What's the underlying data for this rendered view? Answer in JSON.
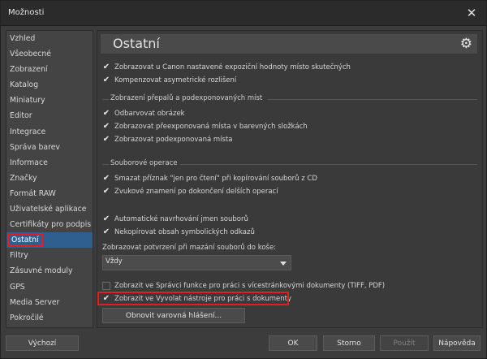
{
  "window": {
    "title": "Možnosti",
    "close_symbol": "✕"
  },
  "sidebar": {
    "items": [
      {
        "label": "Vzhled",
        "active": false
      },
      {
        "label": "Všeobecné",
        "active": false
      },
      {
        "label": "Zobrazení",
        "active": false
      },
      {
        "label": "Katalog",
        "active": false
      },
      {
        "label": "Miniatury",
        "active": false
      },
      {
        "label": "Editor",
        "active": false
      },
      {
        "label": "Integrace",
        "active": false
      },
      {
        "label": "Správa barev",
        "active": false
      },
      {
        "label": "Informace",
        "active": false
      },
      {
        "label": "Značky",
        "active": false
      },
      {
        "label": "Formát RAW",
        "active": false
      },
      {
        "label": "Uživatelské aplikace",
        "active": false
      },
      {
        "label": "Certifikáty pro podpis",
        "active": false
      },
      {
        "label": "Ostatní",
        "active": true
      },
      {
        "label": "Filtry",
        "active": false
      },
      {
        "label": "Zásuvné moduly",
        "active": false
      },
      {
        "label": "GPS",
        "active": false
      },
      {
        "label": "Media Server",
        "active": false
      },
      {
        "label": "Pokročilé",
        "active": false
      }
    ]
  },
  "main": {
    "title": "Ostatní",
    "gear_icon": "gear-icon",
    "checkboxes_top": [
      {
        "label": "Zobrazovat u Canon nastavené expoziční hodnoty místo skutečných",
        "checked": true
      },
      {
        "label": "Kompenzovat asymetrické rozlišení",
        "checked": true
      }
    ],
    "group_exposure": {
      "title": "Zobrazení přepalů a podexponovaných míst",
      "items": [
        {
          "label": "Odbarvovat obrázek",
          "checked": true
        },
        {
          "label": "Zobrazovat přeexponovaná místa v barevných složkách",
          "checked": true
        },
        {
          "label": "Zobrazovat podexponovaná místa",
          "checked": true
        }
      ]
    },
    "group_files": {
      "title": "Souborové operace",
      "items": [
        {
          "label": "Smazat příznak \"jen pro čtení\" při kopírování souborů z CD",
          "checked": true
        },
        {
          "label": "Zvukové znamení po dokončení delších operací",
          "checked": true
        }
      ]
    },
    "checkboxes_misc": [
      {
        "label": "Automatické navrhování jmen souborů",
        "checked": true
      },
      {
        "label": "Nekopírovat obsah symbolických odkazů",
        "checked": true
      }
    ],
    "trash_confirm": {
      "label": "Zobrazovat potvrzení při mazání souborů do koše:",
      "value": "Vždy"
    },
    "checkboxes_bottom": [
      {
        "label": "Zobrazit ve Správci funkce pro práci s vícestránkovými dokumenty (TIFF, PDF)",
        "checked": false
      },
      {
        "label": "Zobrazit ve Vyvolat nástroje pro práci s dokumenty",
        "checked": true
      }
    ],
    "reset_warnings_button": "Obnovit varovná hlášení..."
  },
  "footer": {
    "default_button": "Výchozí",
    "ok_button": "OK",
    "cancel_button": "Storno",
    "apply_button": "Použít",
    "help_button": "Nápověda"
  },
  "colors": {
    "accent": "#2e5f8f",
    "highlight_box": "#e02020"
  }
}
